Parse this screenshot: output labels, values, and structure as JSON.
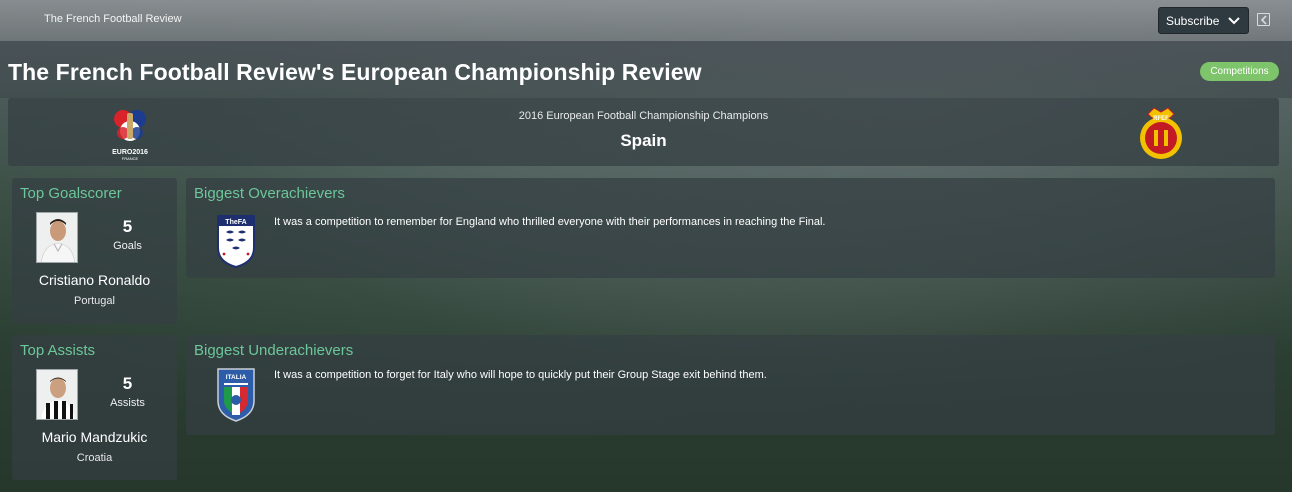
{
  "header": {
    "source_name": "The French Football Review",
    "subscribe_label": "Subscribe",
    "title": "The French Football Review's European Championship Review",
    "category_badge": "Competitions"
  },
  "champions": {
    "subtitle": "2016 European Football Championship Champions",
    "team": "Spain",
    "competition_logo_text": "EURO2016",
    "competition_logo_subtext": "FRANCE",
    "team_logo_text": "RFEF"
  },
  "top_goalscorer": {
    "heading": "Top Goalscorer",
    "value": "5",
    "unit": "Goals",
    "player": "Cristiano Ronaldo",
    "nation": "Portugal"
  },
  "top_assists": {
    "heading": "Top Assists",
    "value": "5",
    "unit": "Assists",
    "player": "Mario Mandzukic",
    "nation": "Croatia"
  },
  "overachievers": {
    "heading": "Biggest Overachievers",
    "text": "It was a competition to remember for England who thrilled everyone with their performances in reaching the Final.",
    "crest_text": "TheFA"
  },
  "underachievers": {
    "heading": "Biggest Underachievers",
    "text": "It was a competition to forget for Italy who will hope to quickly put their Group Stage exit behind them.",
    "crest_text": "ITALIA"
  },
  "colors": {
    "accent_green": "#6cc79a",
    "badge_green": "#7dc46a",
    "panel": "#343e42"
  },
  "icons": [
    "chevron-down-icon",
    "back-arrow-icon",
    "euro2016-logo",
    "rfef-crest",
    "england-fa-crest",
    "italy-figc-crest"
  ]
}
